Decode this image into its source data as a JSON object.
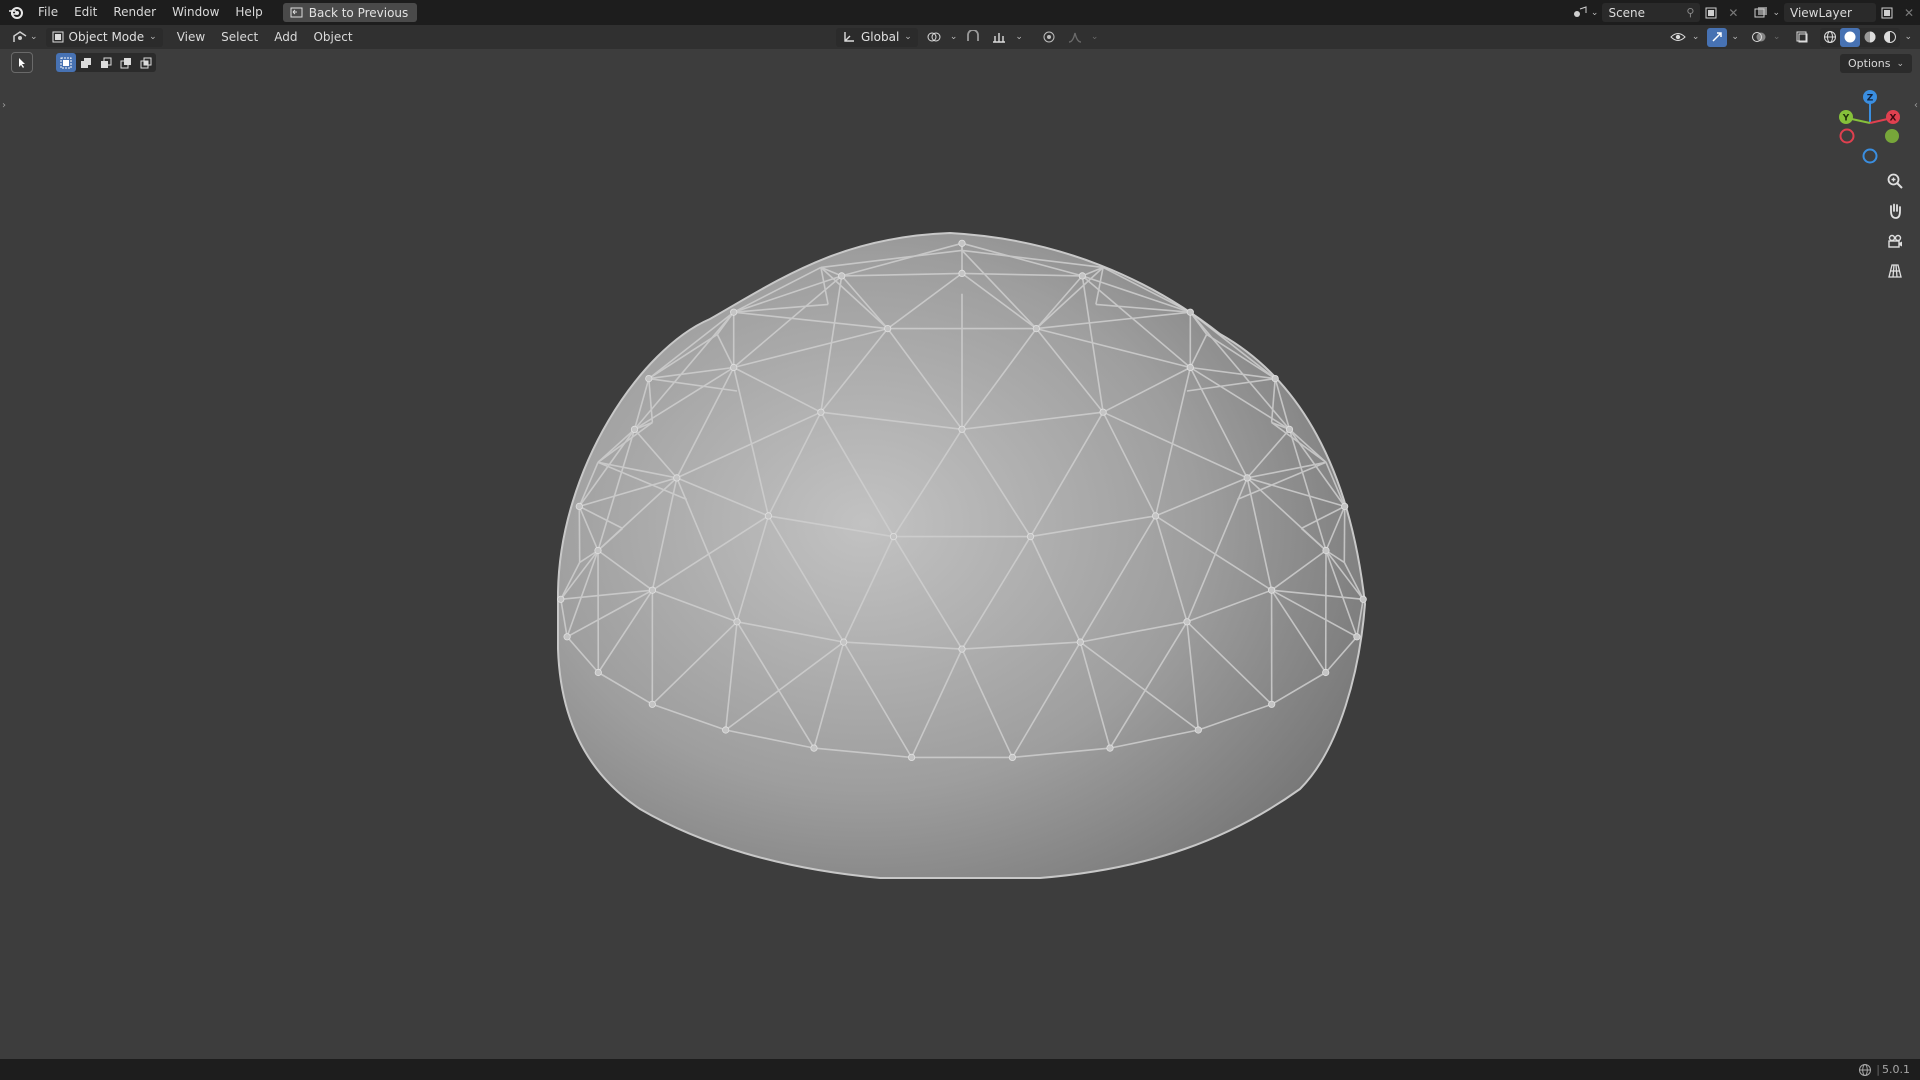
{
  "topbar": {
    "menus": [
      "File",
      "Edit",
      "Render",
      "Window",
      "Help"
    ],
    "back_button": "Back to Previous",
    "scene_name": "Scene",
    "view_layer": "ViewLayer"
  },
  "header": {
    "mode": "Object Mode",
    "menus": [
      "View",
      "Select",
      "Add",
      "Object"
    ],
    "transform_orientation": "Global"
  },
  "toolbar": {
    "options_label": "Options"
  },
  "gizmo": {
    "axes": [
      "Z",
      "Y",
      "X"
    ],
    "colors": {
      "x": "#e0404f",
      "y": "#86c13a",
      "z": "#3a8ee0"
    }
  },
  "viewport": {
    "object": "geodesic-dome",
    "background": "#3d3d3d",
    "mesh_color": "#9c9c9c"
  },
  "status": {
    "version": "5.0.1"
  }
}
